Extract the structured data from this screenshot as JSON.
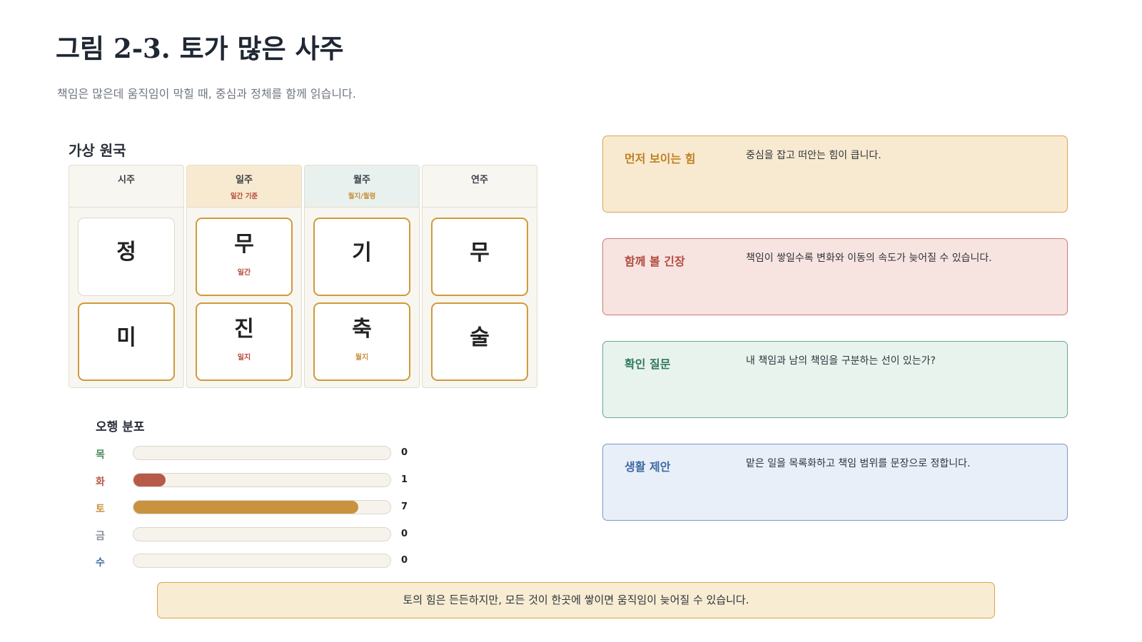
{
  "title": "그림 2-3. 토가 많은 사주",
  "subtitle": "책임은 많은데 움직임이 막힐 때, 중심과 정체를 함께 읽습니다.",
  "chart": {
    "title": "가상 원국",
    "pillars": [
      {
        "name": "시주",
        "note": "",
        "stem": "정",
        "stem_note": "",
        "branch": "미",
        "branch_note": ""
      },
      {
        "name": "일주",
        "note": "일간 기준",
        "stem": "무",
        "stem_note": "일간",
        "branch": "진",
        "branch_note": "일지"
      },
      {
        "name": "월주",
        "note": "월지/월령",
        "stem": "기",
        "stem_note": "",
        "branch": "축",
        "branch_note": "월지"
      },
      {
        "name": "연주",
        "note": "",
        "stem": "무",
        "stem_note": "",
        "branch": "술",
        "branch_note": ""
      }
    ]
  },
  "distribution": {
    "title": "오행 분포",
    "max": 8,
    "items": [
      {
        "label": "목",
        "value": 0,
        "color": "#4f8a5b"
      },
      {
        "label": "화",
        "value": 1,
        "color": "#b85a4a"
      },
      {
        "label": "토",
        "value": 7,
        "color": "#c8923e"
      },
      {
        "label": "금",
        "value": 0,
        "color": "#8a8f98"
      },
      {
        "label": "수",
        "value": 0,
        "color": "#3f6e9f"
      }
    ]
  },
  "cards": [
    {
      "label": "먼저 보이는 힘",
      "text": "중심을 잡고 떠안는 힘이 큽니다.",
      "bg": "#f8ead0",
      "border": "#d9a552",
      "color": "#c07f22"
    },
    {
      "label": "함께 볼 긴장",
      "text": "책임이 쌓일수록 변화와 이동의 속도가 늦어질 수 있습니다.",
      "bg": "#f7e4e1",
      "border": "#cc7b72",
      "color": "#b24a3e"
    },
    {
      "label": "확인 질문",
      "text": "내 책임과 남의 책임을 구분하는 선이 있는가?",
      "bg": "#e9f3ee",
      "border": "#6aa593",
      "color": "#2f7a5d"
    },
    {
      "label": "생활 제안",
      "text": "맡은 일을 목록화하고 책임 범위를 문장으로 정합니다.",
      "bg": "#e9eff8",
      "border": "#7a9bc4",
      "color": "#3d6aa3"
    }
  ],
  "footer": "토의 힘은 든든하지만, 모든 것이 한곳에 쌓이면 움직임이 늦어질 수 있습니다.",
  "colors": {
    "head_ilju": "#f8ead0",
    "head_wolju": "#e8f1ee",
    "note_ilju": "#b5473b",
    "note_wolju": "#c8923e"
  }
}
